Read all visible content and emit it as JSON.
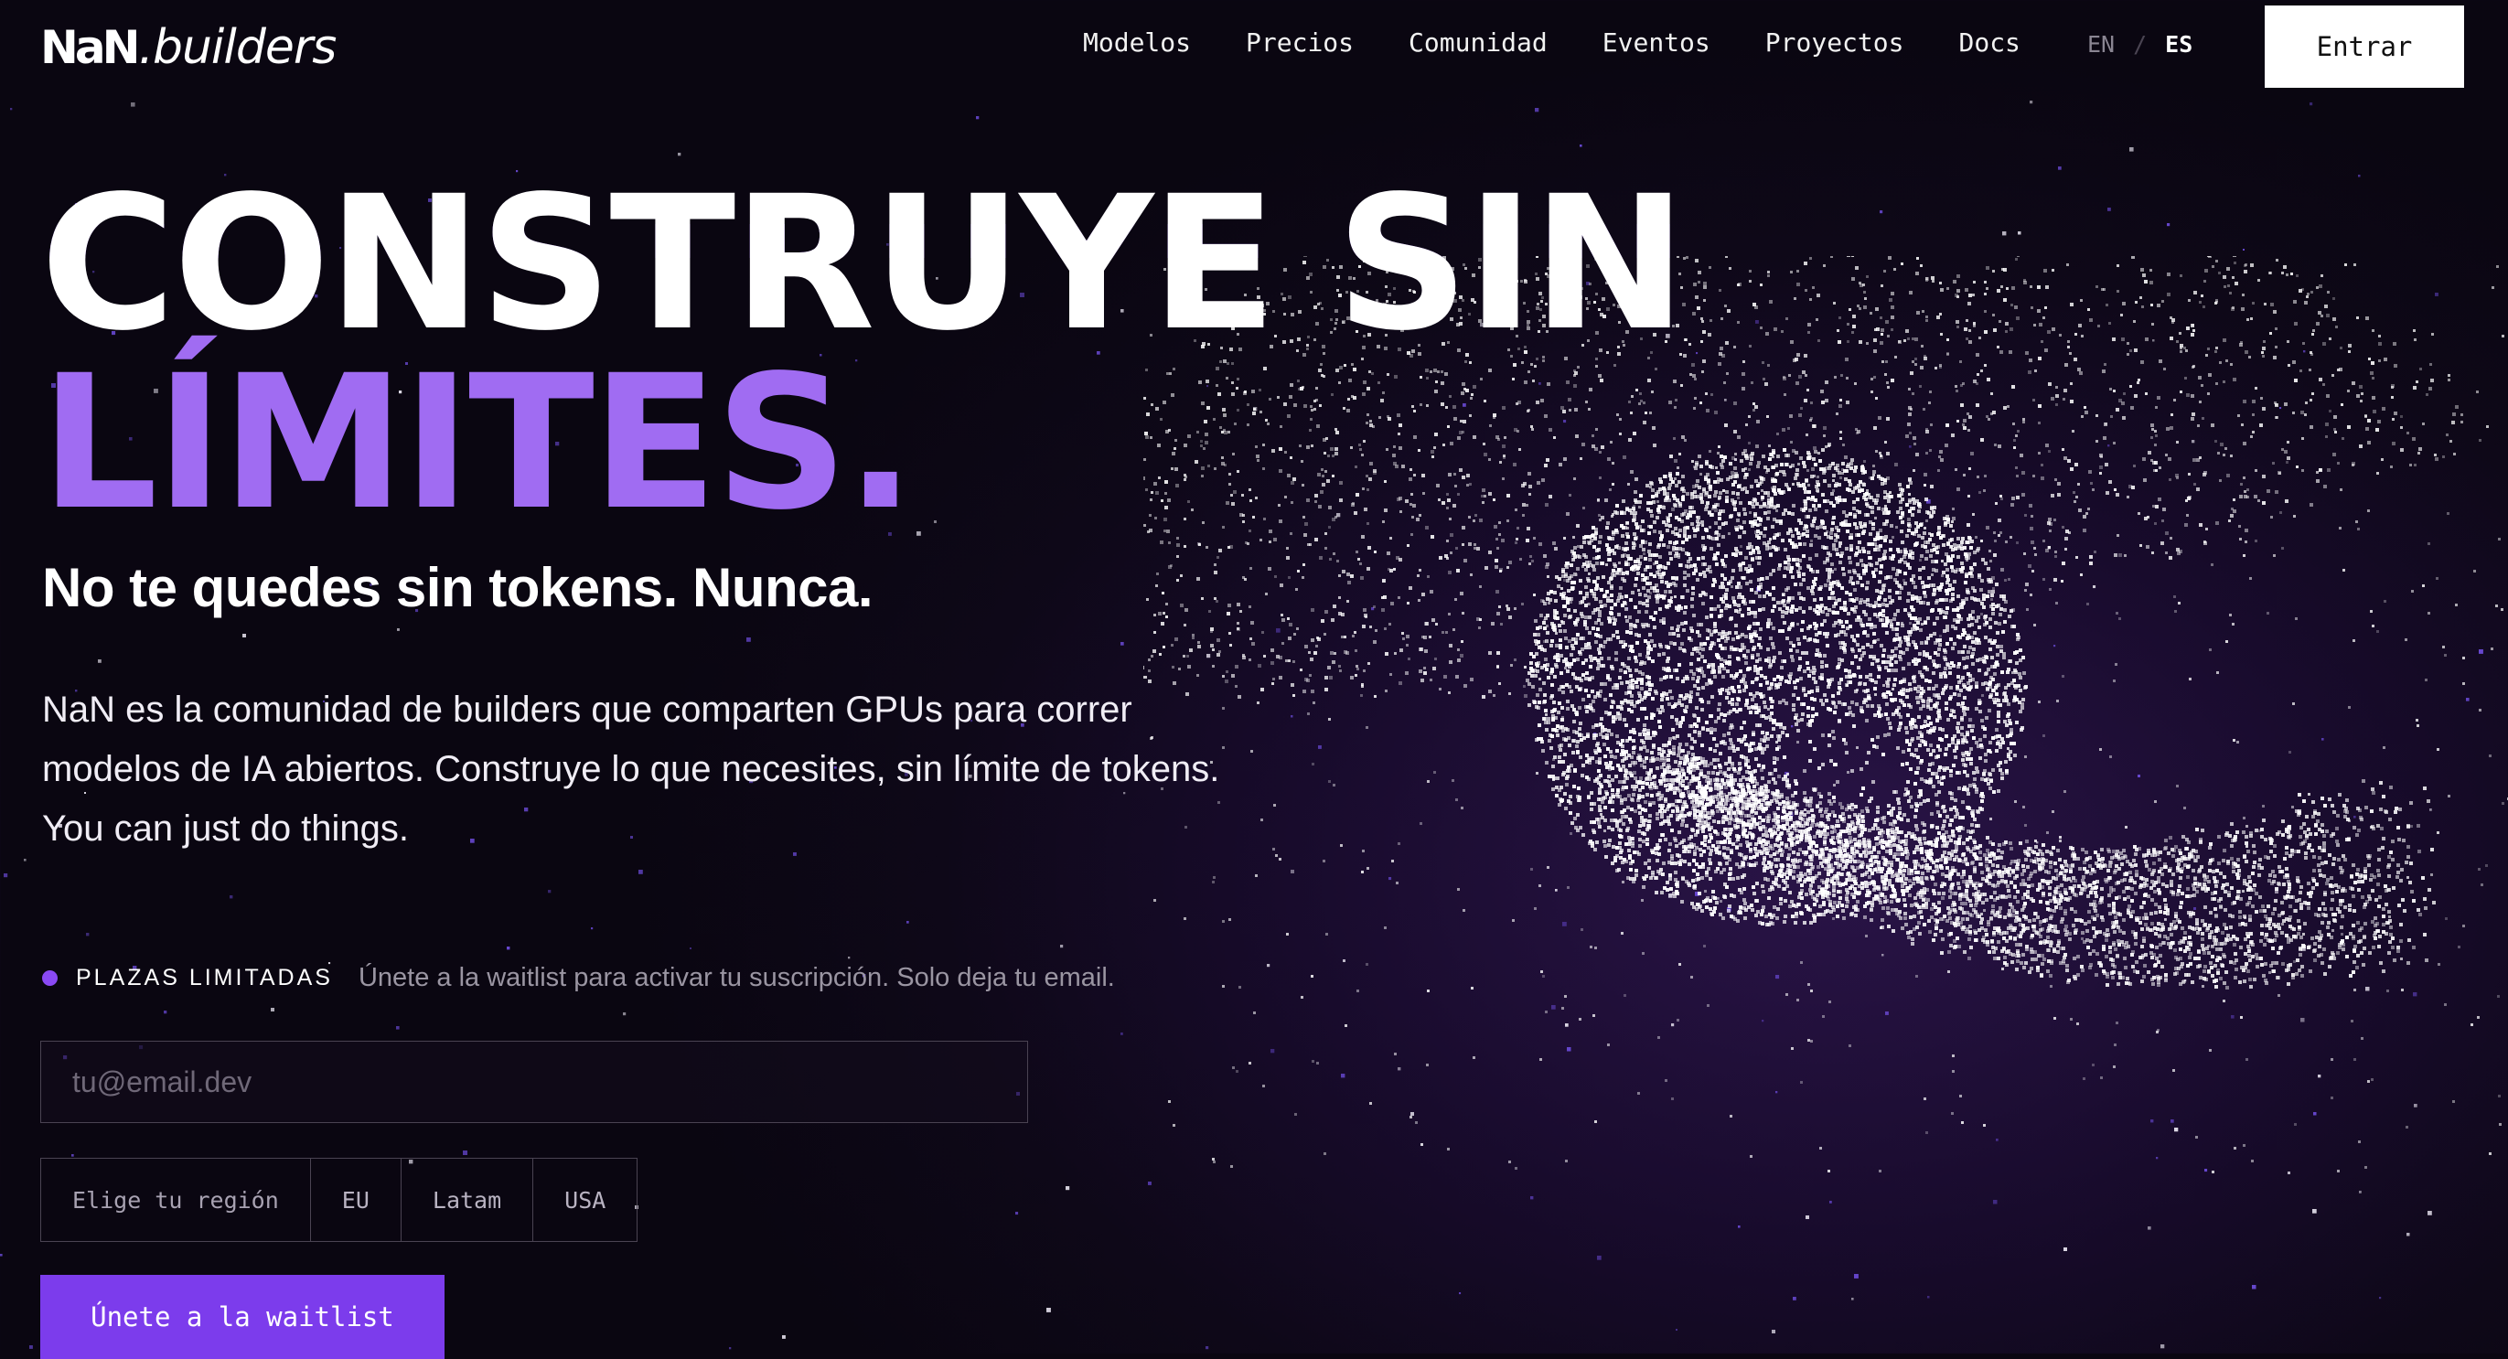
{
  "brand": {
    "mark": "NaN",
    "name": ".builders"
  },
  "nav": {
    "links": [
      "Modelos",
      "Precios",
      "Comunidad",
      "Eventos",
      "Proyectos",
      "Docs"
    ],
    "lang_en": "EN",
    "lang_sep": "/",
    "lang_es": "ES",
    "login_label": "Entrar"
  },
  "hero": {
    "title_line1": "CONSTRUYE SIN",
    "title_line2": "LÍMITES.",
    "subtitle": "No te quedes sin tokens. Nunca.",
    "description": "NaN es la comunidad de builders que comparten GPUs para correr modelos de IA abiertos. Construye lo que necesites, sin límite de tokens. You can just do things."
  },
  "waitlist": {
    "badge": "PLAZAS LIMITADAS",
    "note": "Únete a la waitlist para activar tu suscripción. Solo deja tu email.",
    "email_placeholder": "tu@email.dev",
    "region_label": "Elige tu región",
    "regions": [
      "EU",
      "Latam",
      "USA"
    ],
    "cta_label": "Únete a la waitlist"
  },
  "colors": {
    "accent": "#7c3cec",
    "accent_light": "#a06cf2",
    "background": "#0e0818"
  },
  "icons": [
    "status-dot-icon",
    "particle-sphere-illustration"
  ]
}
